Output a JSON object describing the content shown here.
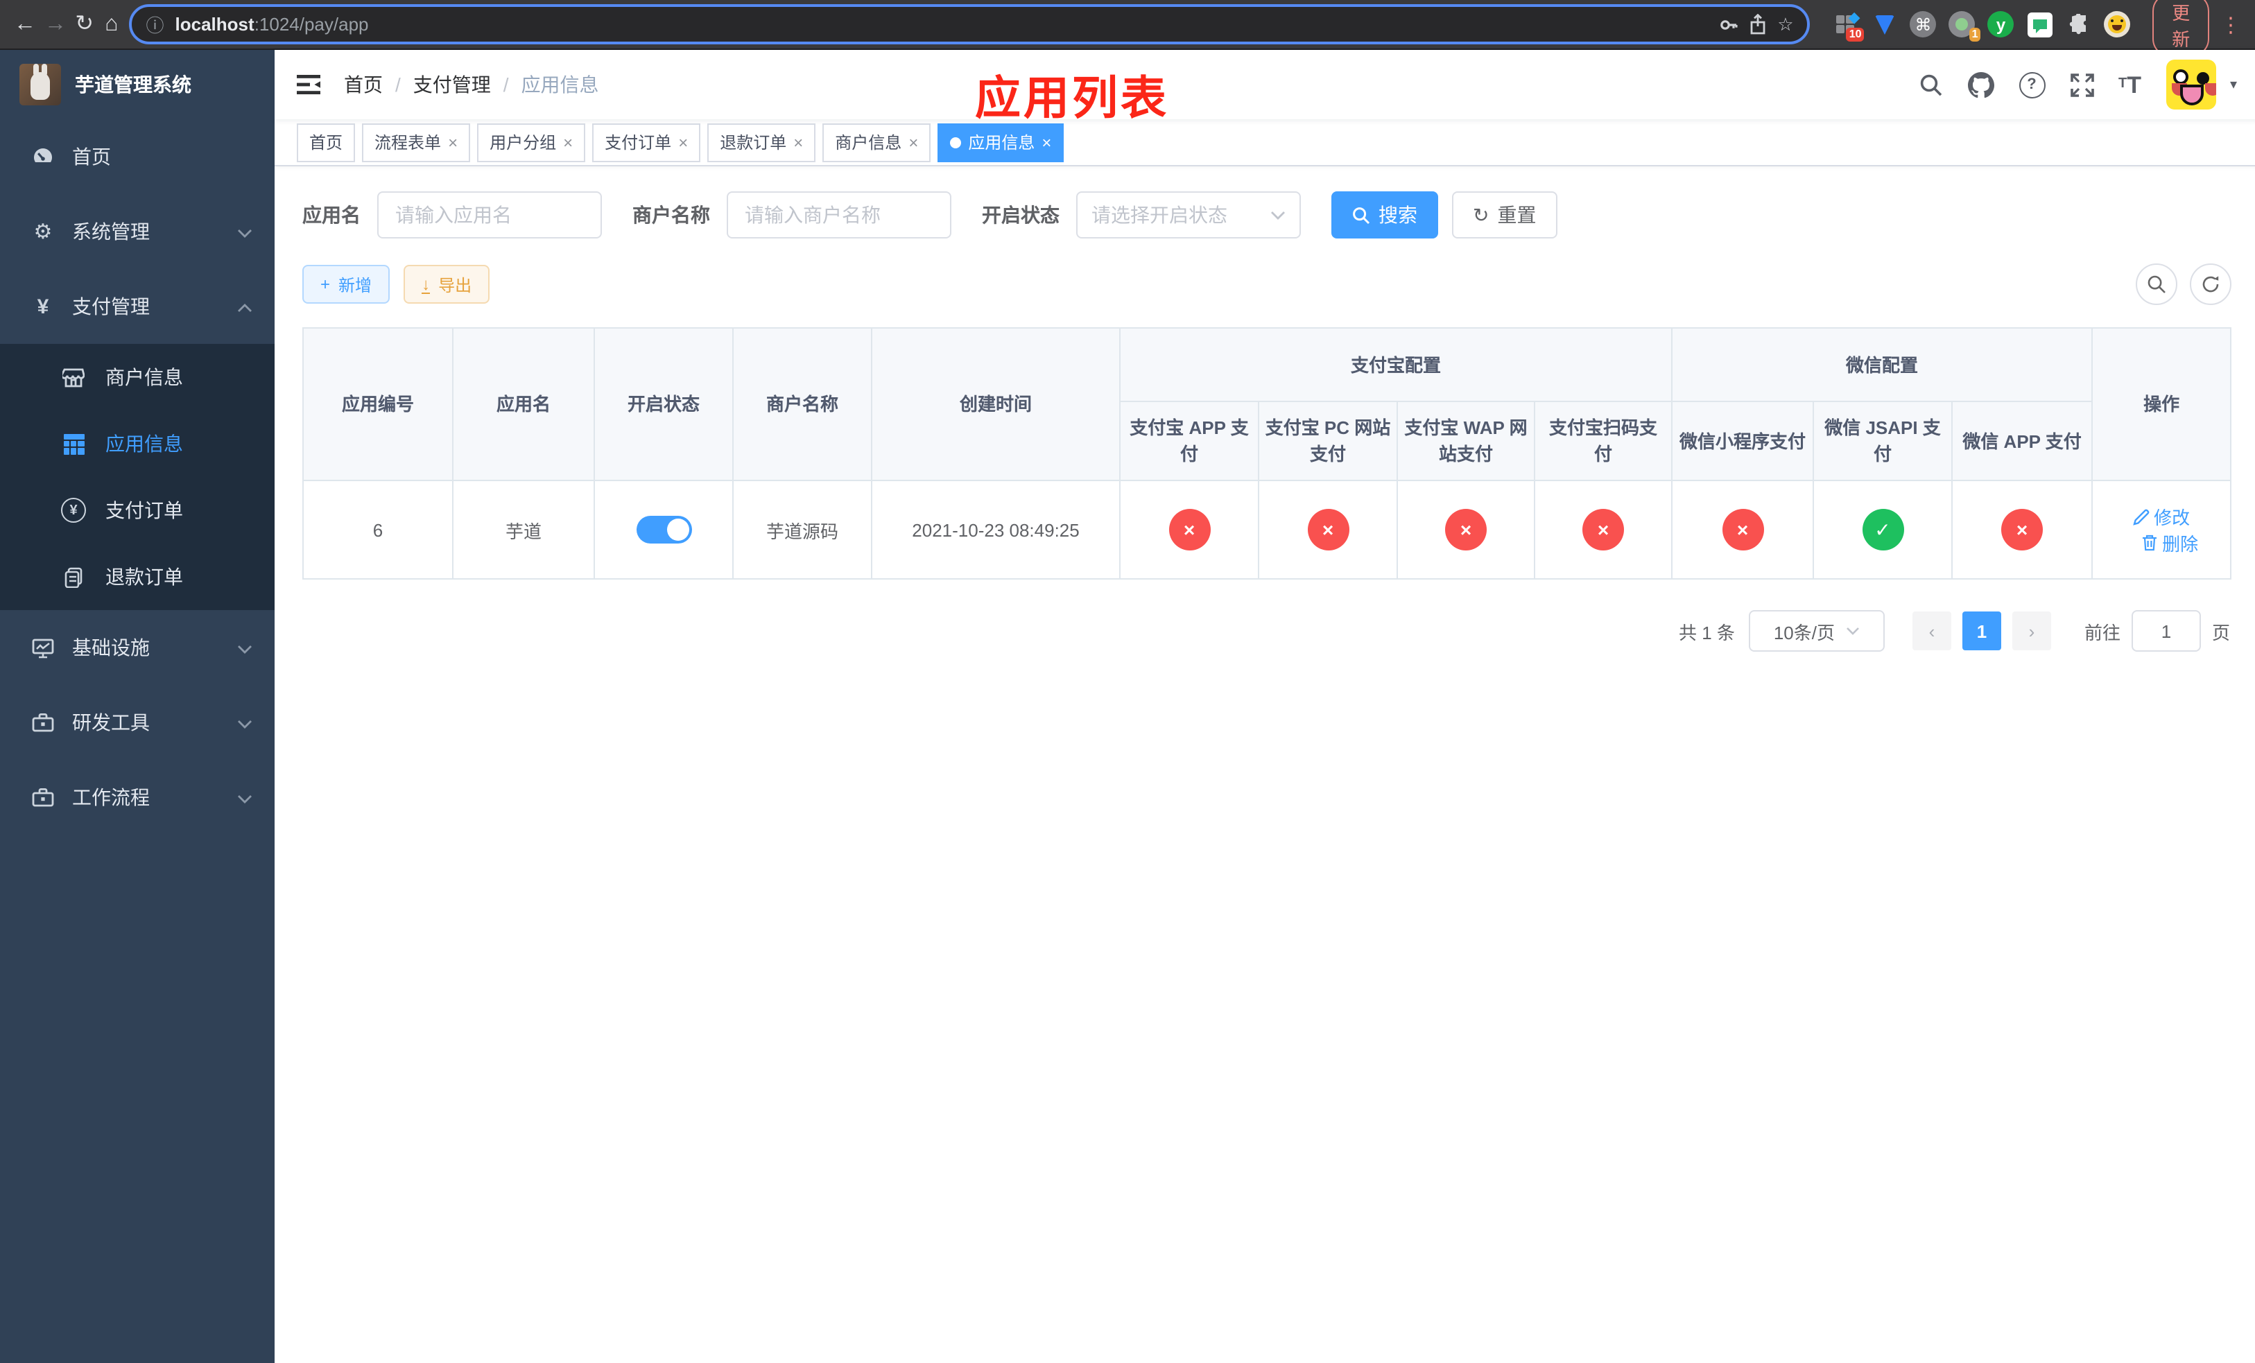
{
  "colors": {
    "accent": "#409eff",
    "danger": "#f9514f",
    "success": "#1ec05f",
    "warning": "#e6a23c",
    "sidebar_bg": "#304156",
    "submenu_bg": "#1f2d3d",
    "overlay_title_red": "#fb2618"
  },
  "browser": {
    "url_host": "localhost",
    "url_rest": ":1024/pay/app",
    "update_label": "更新",
    "ext_badge_blue_diamond": "10",
    "ext_badge_green_dot": "1",
    "ext_letter": "y"
  },
  "glyphs": {
    "back": "←",
    "forward": "→",
    "reload": "↻",
    "home": "⌂",
    "info": "ⓘ",
    "star": "☆",
    "cmd": "⌘",
    "kebab": "⋮",
    "slash": "/",
    "close": "×",
    "caret_down": "▾",
    "gear": "⚙",
    "yuan": "¥",
    "check": "✓",
    "cross": "×",
    "plus": "+",
    "down_arrow": "↓",
    "question": "?",
    "prev": "‹",
    "next": "›",
    "t_small": "T",
    "t_big": "T"
  },
  "sidebar": {
    "title": "芋道管理系统",
    "items": [
      {
        "label": "首页"
      },
      {
        "label": "系统管理"
      },
      {
        "label": "支付管理"
      }
    ],
    "submenu": [
      {
        "label": "商户信息"
      },
      {
        "label": "应用信息"
      },
      {
        "label": "支付订单"
      },
      {
        "label": "退款订单"
      }
    ],
    "items_bottom": [
      {
        "label": "基础设施"
      },
      {
        "label": "研发工具"
      },
      {
        "label": "工作流程"
      }
    ]
  },
  "breadcrumb": {
    "parts": [
      "首页",
      "支付管理",
      "应用信息"
    ]
  },
  "overlay_title": "应用列表",
  "tabs": [
    {
      "label": "首页"
    },
    {
      "label": "流程表单"
    },
    {
      "label": "用户分组"
    },
    {
      "label": "支付订单"
    },
    {
      "label": "退款订单"
    },
    {
      "label": "商户信息"
    },
    {
      "label": "应用信息"
    }
  ],
  "filters": {
    "app_name_label": "应用名",
    "app_name_placeholder": "请输入应用名",
    "merchant_label": "商户名称",
    "merchant_placeholder": "请输入商户名称",
    "status_label": "开启状态",
    "status_placeholder": "请选择开启状态",
    "search_label": "搜索",
    "reset_label": "重置"
  },
  "toolbar": {
    "add_label": "新增",
    "export_label": "导出"
  },
  "table": {
    "main_columns": [
      "应用编号",
      "应用名",
      "开启状态",
      "商户名称",
      "创建时间"
    ],
    "groups": [
      {
        "label": "支付宝配置"
      },
      {
        "label": "微信配置"
      }
    ],
    "pay_columns": [
      "支付宝 APP 支付",
      "支付宝 PC 网站支付",
      "支付宝 WAP 网站支付",
      "支付宝扫码支付",
      "微信小程序支付",
      "微信 JSAPI 支付",
      "微信 APP 支付"
    ],
    "ops_column": "操作",
    "rows": [
      {
        "id": "6",
        "app_name": "芋道",
        "enabled": true,
        "merchant_name": "芋道源码",
        "create_time": "2021-10-23 08:49:25",
        "pay_status": [
          false,
          false,
          false,
          false,
          false,
          true,
          false
        ],
        "actions": [
          "修改",
          "删除"
        ]
      }
    ]
  },
  "pagination": {
    "total": "共 1 条",
    "page_size": "10条/页",
    "current_page": "1",
    "goto_label": "前往",
    "page_unit": "页",
    "goto_value": "1"
  }
}
